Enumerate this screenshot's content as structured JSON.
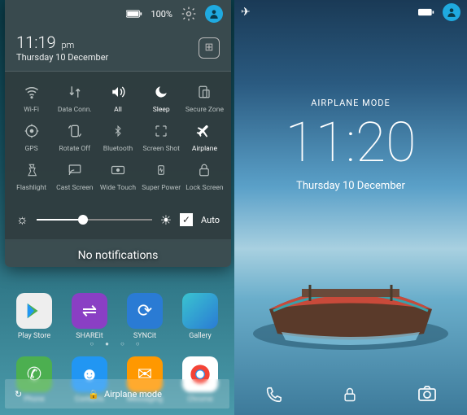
{
  "left": {
    "status": {
      "battery_pct": "100%"
    },
    "time": "11:19",
    "am_pm": "pm",
    "date": "Thursday 10 December",
    "qs": [
      {
        "label": "Wi-Fi",
        "icon": "wifi",
        "active": false
      },
      {
        "label": "Data Conn.",
        "icon": "data",
        "active": false
      },
      {
        "label": "All",
        "icon": "volume",
        "active": true
      },
      {
        "label": "Sleep",
        "icon": "sleep",
        "active": true
      },
      {
        "label": "Secure Zone",
        "icon": "secure",
        "active": false
      },
      {
        "label": "GPS",
        "icon": "gps",
        "active": false
      },
      {
        "label": "Rotate Off",
        "icon": "rotate",
        "active": false
      },
      {
        "label": "Bluetooth",
        "icon": "bt",
        "active": false
      },
      {
        "label": "Screen Shot",
        "icon": "screenshot",
        "active": false
      },
      {
        "label": "Airplane",
        "icon": "airplane",
        "active": true
      },
      {
        "label": "Flashlight",
        "icon": "flash",
        "active": false
      },
      {
        "label": "Cast Screen",
        "icon": "cast",
        "active": false
      },
      {
        "label": "Wide Touch",
        "icon": "wide",
        "active": false
      },
      {
        "label": "Super Power",
        "icon": "power",
        "active": false
      },
      {
        "label": "Lock Screen",
        "icon": "lock",
        "active": false
      }
    ],
    "brightness": {
      "auto_label": "Auto",
      "auto_checked": true,
      "value": 36
    },
    "no_notif": "No notifications",
    "apps_row1": [
      {
        "label": "Play Store",
        "color": "#eee"
      },
      {
        "label": "SHAREit",
        "color": "#8a3fc4"
      },
      {
        "label": "SYNCit",
        "color": "#2a7bd4"
      },
      {
        "label": "Gallery",
        "color": "#3ac4d0"
      }
    ],
    "dock": [
      {
        "label": "Phone",
        "color": "#4caf50"
      },
      {
        "label": "Contacts",
        "color": "#2196f3"
      },
      {
        "label": "Messaging",
        "color": "#ff9800"
      },
      {
        "label": "Chrome",
        "color": "#f44336"
      }
    ],
    "toast": {
      "text": "Airplane mode",
      "icon": "airplane"
    }
  },
  "right": {
    "mode": "AIRPLANE MODE",
    "time": "11:20",
    "date": "Thursday 10 December",
    "actions": [
      "phone",
      "lock",
      "camera"
    ]
  },
  "colors": {
    "accent": "#1faae0"
  }
}
